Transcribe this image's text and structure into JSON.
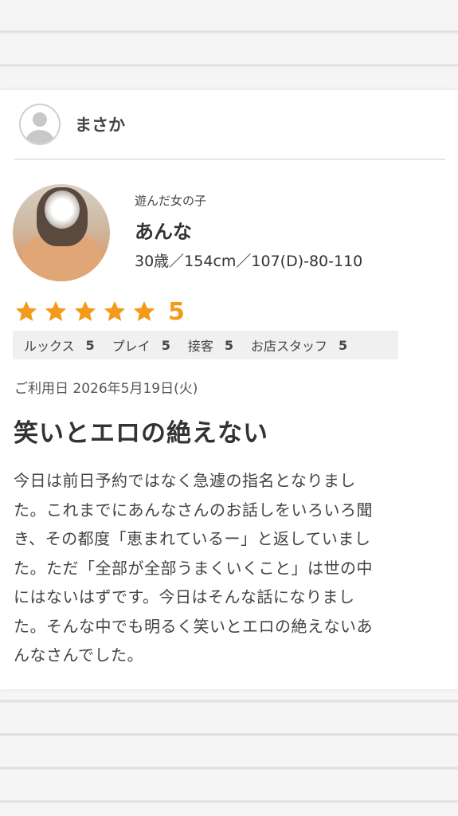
{
  "reviewer": {
    "name": "まさか",
    "avatar_icon": "user-avatar-icon"
  },
  "girl": {
    "caption": "遊んだ女の子",
    "name": "あんな",
    "spec": "30歳／154cm／107(D)-80-110"
  },
  "rating": {
    "stars": 5,
    "value": "5",
    "star_color": "#f39a1a"
  },
  "subscores": [
    {
      "label": "ルックス",
      "value": "5"
    },
    {
      "label": "プレイ",
      "value": "5"
    },
    {
      "label": "接客",
      "value": "5"
    },
    {
      "label": "お店スタッフ",
      "value": "5"
    }
  ],
  "review": {
    "date": "ご利用日 2026年5月19日(火)",
    "title": "笑いとエロの絶えない",
    "body_lines": [
      "今日は前日予約ではなく急遽の指名となりまし",
      "た。これまでにあんなさんのお話しをいろいろ聞",
      "き、その都度「恵まれているー」と返していまし",
      "た。ただ「全部が全部うまくいくこと」は世の中",
      "にはないはずです。今日はそんな話になりまし",
      "た。そんな中でも明るく笑いとエロの絶えないあ",
      "んなさんでした。"
    ]
  }
}
